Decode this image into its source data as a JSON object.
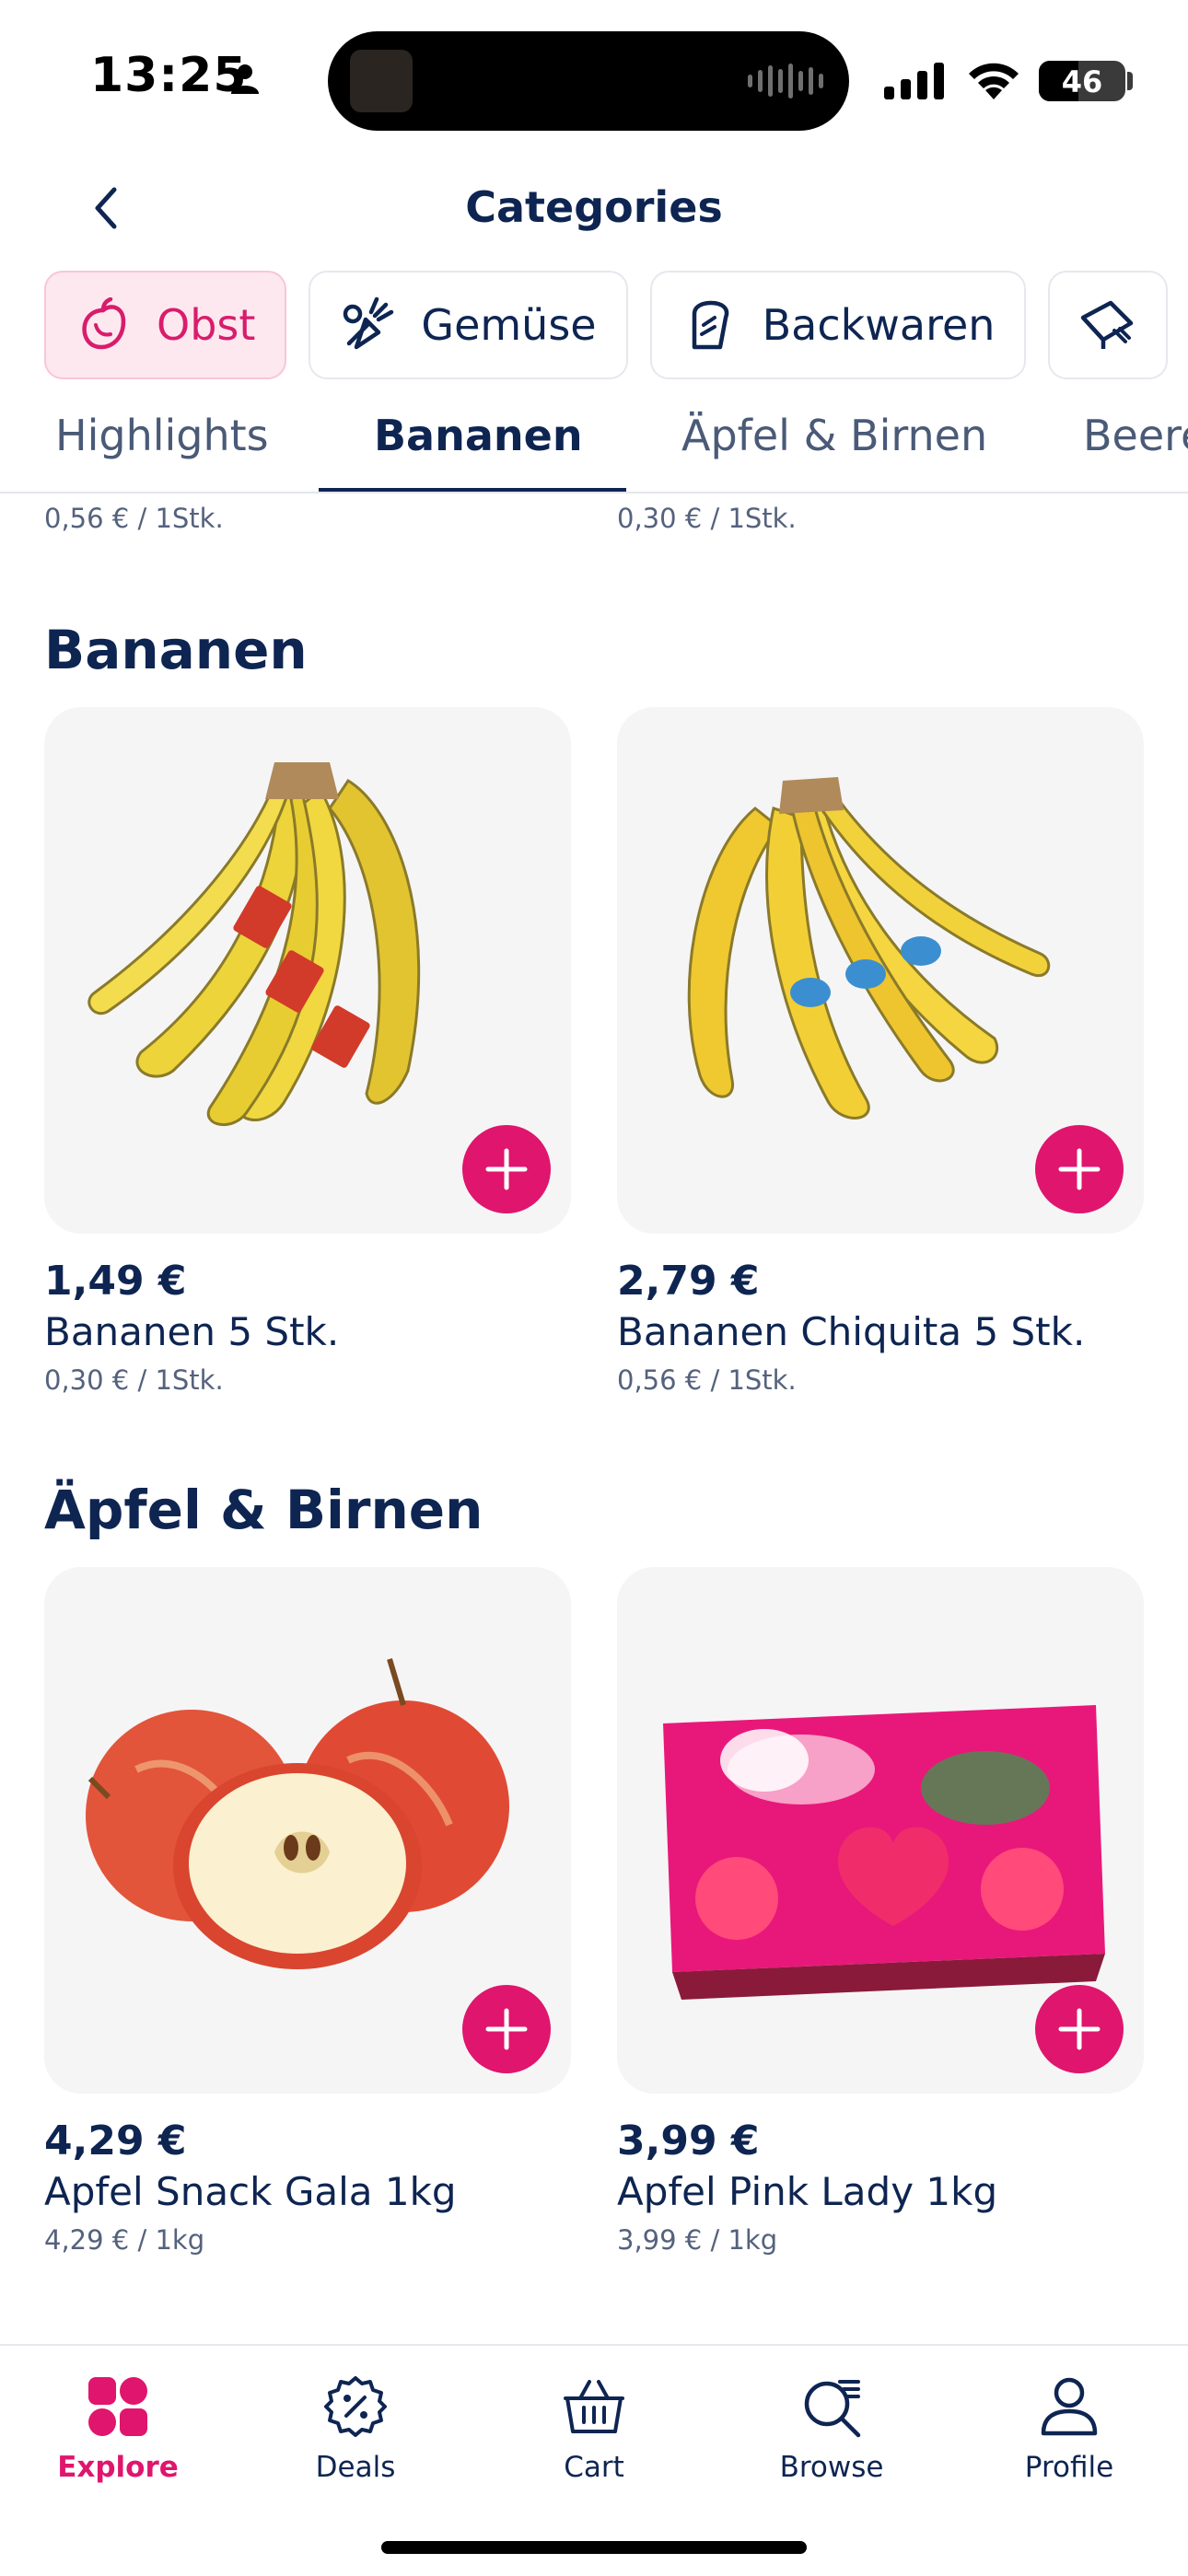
{
  "status_bar": {
    "time": "13:25",
    "battery": "46",
    "battery_level": 0.46
  },
  "header": {
    "title": "Categories"
  },
  "categories": [
    {
      "label": "Obst",
      "icon": "fruit-icon",
      "active": true
    },
    {
      "label": "Gemüse",
      "icon": "vegetable-icon",
      "active": false
    },
    {
      "label": "Backwaren",
      "icon": "bread-icon",
      "active": false
    },
    {
      "label": "",
      "icon": "dairy-icon",
      "active": false
    }
  ],
  "tabs": [
    {
      "label": "Highlights",
      "active": false
    },
    {
      "label": "Bananen",
      "active": true
    },
    {
      "label": "Äpfel & Birnen",
      "active": false
    },
    {
      "label": "Beere",
      "active": false
    }
  ],
  "previous_row_units": [
    "0,56 € / 1Stk.",
    "0,30 € / 1Stk."
  ],
  "sections": [
    {
      "title": "Bananen",
      "products": [
        {
          "price": "1,49 €",
          "name": "Bananen 5 Stk.",
          "unit": "0,30 € / 1Stk.",
          "image": "banana-bunch-label"
        },
        {
          "price": "2,79 €",
          "name": "Bananen Chiquita 5 Stk.",
          "unit": "0,56 € / 1Stk.",
          "image": "banana-bunch-chiquita"
        }
      ]
    },
    {
      "title": "Äpfel & Birnen",
      "products": [
        {
          "price": "4,29 €",
          "name": "Apfel Snack Gala 1kg",
          "unit": "4,29 € / 1kg",
          "image": "gala-apples"
        },
        {
          "price": "3,99 €",
          "name": "Apfel Pink Lady 1kg",
          "unit": "3,99 € / 1kg",
          "image": "pink-lady-box"
        }
      ]
    }
  ],
  "bottom_nav": [
    {
      "label": "Explore",
      "icon": "explore-icon",
      "active": true
    },
    {
      "label": "Deals",
      "icon": "deals-icon",
      "active": false
    },
    {
      "label": "Cart",
      "icon": "cart-icon",
      "active": false
    },
    {
      "label": "Browse",
      "icon": "browse-icon",
      "active": false
    },
    {
      "label": "Profile",
      "icon": "profile-icon",
      "active": false
    }
  ],
  "colors": {
    "accent": "#e0156d",
    "text": "#0e2552",
    "chip_active_bg": "#fde8ef"
  }
}
